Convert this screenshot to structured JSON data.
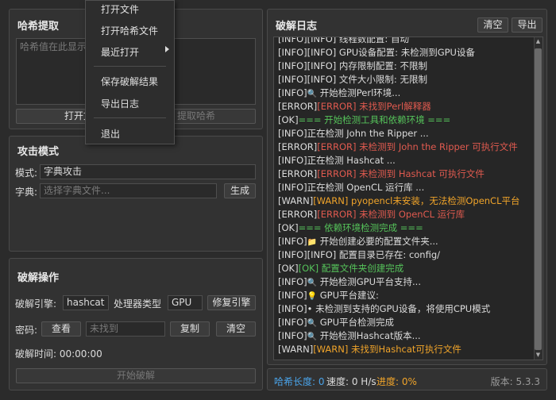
{
  "hash_panel": {
    "title": "哈希提取",
    "textarea_placeholder": "哈希值在此显示",
    "open_button": "打开文",
    "extract_button": "提取哈希"
  },
  "menu": {
    "items": [
      {
        "label": "打开文件"
      },
      {
        "label": "打开哈希文件"
      },
      {
        "label": "最近打开",
        "submenu": true
      },
      {
        "label": "保存破解结果"
      },
      {
        "label": "导出日志"
      },
      {
        "label": "退出"
      }
    ]
  },
  "attack_panel": {
    "title": "攻击模式",
    "mode_label": "模式:",
    "mode_value": "字典攻击",
    "dict_label": "字典:",
    "dict_placeholder": "选择字典文件...",
    "generate_button": "生成"
  },
  "crack_panel": {
    "title": "破解操作",
    "engine_label": "破解引擎:",
    "engine_value": "hashcat",
    "proc_label": "处理器类型",
    "proc_value": "GPU",
    "repair_button": "修复引擎",
    "password_label": "密码:",
    "view_button": "查看",
    "password_value": "未找到",
    "copy_button": "复制",
    "clear_button": "清空",
    "time_label": "破解时间: 00:00:00",
    "start_button": "开始破解"
  },
  "log_panel": {
    "title": "破解日志",
    "clear_button": "清空",
    "export_button": "导出",
    "lines": [
      {
        "type": "info",
        "p": "[INFO][INFO] 线程数配置: 自动",
        "m": ""
      },
      {
        "type": "info",
        "p": "[INFO][INFO] GPU设备配置: 未检测到GPU设备",
        "m": ""
      },
      {
        "type": "info",
        "p": "[INFO][INFO] 内存限制配置: 不限制",
        "m": ""
      },
      {
        "type": "info",
        "p": "[INFO][INFO] 文件大小限制: 无限制",
        "m": ""
      },
      {
        "type": "info",
        "p": "[INFO]",
        "icon": "🔍",
        "m": " 开始检测Perl环境..."
      },
      {
        "type": "err",
        "p": "[ERROR]",
        "m": "[ERROR] 未找到Perl解释器"
      },
      {
        "type": "ok",
        "p": "[OK]",
        "m": "=== 开始检测工具和依赖环境 ==="
      },
      {
        "type": "info",
        "p": "[INFO]正在检测 John the Ripper ...",
        "m": ""
      },
      {
        "type": "err",
        "p": "[ERROR]",
        "m": "[ERROR] 未检测到 John the Ripper 可执行文件"
      },
      {
        "type": "info",
        "p": "[INFO]正在检测 Hashcat ...",
        "m": ""
      },
      {
        "type": "err",
        "p": "[ERROR]",
        "m": "[ERROR] 未检测到 Hashcat 可执行文件"
      },
      {
        "type": "info",
        "p": "[INFO]正在检测 OpenCL 运行库 ...",
        "m": ""
      },
      {
        "type": "warn",
        "p": "[WARN]",
        "m": "[WARN] pyopencl未安装，无法检测OpenCL平台"
      },
      {
        "type": "err",
        "p": "[ERROR]",
        "m": "[ERROR] 未检测到 OpenCL 运行库"
      },
      {
        "type": "ok",
        "p": "[OK]",
        "m": "=== 依赖环境检测完成 ==="
      },
      {
        "type": "info",
        "p": "[INFO]",
        "icon": "📁",
        "m": " 开始创建必要的配置文件夹..."
      },
      {
        "type": "info",
        "p": "[INFO][INFO] 配置目录已存在: config/",
        "m": ""
      },
      {
        "type": "ok",
        "p": "[OK]",
        "m": "[OK] 配置文件夹创建完成"
      },
      {
        "type": "info",
        "p": "[INFO]",
        "icon": "🔍",
        "m": " 开始检测GPU平台支持..."
      },
      {
        "type": "info",
        "p": "[INFO]",
        "icon": "💡",
        "m": " GPU平台建议:"
      },
      {
        "type": "info",
        "p": "[INFO]• 未检测到支持的GPU设备，将使用CPU模式",
        "m": ""
      },
      {
        "type": "info",
        "p": "[INFO]",
        "icon": "🔍",
        "m": " GPU平台检测完成"
      },
      {
        "type": "info",
        "p": "[INFO]",
        "icon": "🔍",
        "m": " 开始检测Hashcat版本..."
      },
      {
        "type": "warn",
        "p": "[WARN]",
        "m": "[WARN] 未找到Hashcat可执行文件"
      }
    ]
  },
  "status_bar": {
    "hash_len_label": "哈希长度: 0",
    "speed_label": "速度: 0 H/s",
    "progress_label": "进度: 0%",
    "version_label": "版本: 5.3.3"
  },
  "colors": {
    "error": "#e05a4f",
    "ok": "#55c35a",
    "warn": "#f0a42a",
    "hash_len": "#4aa3e8",
    "progress": "#f0a42a"
  }
}
